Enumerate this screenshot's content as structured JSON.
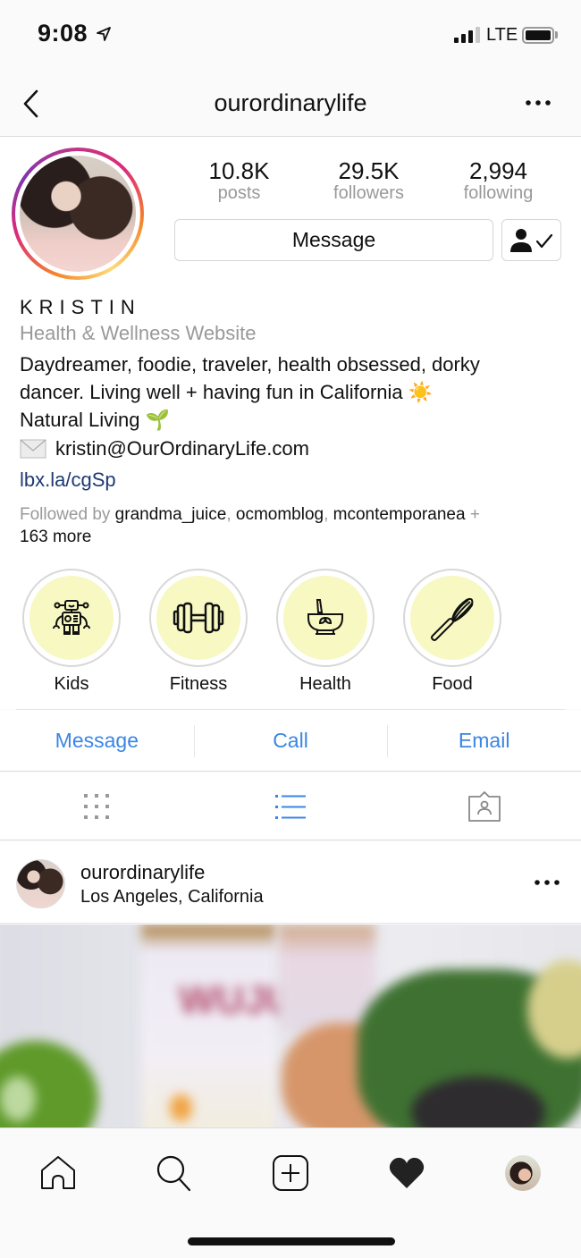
{
  "status_bar": {
    "time": "9:08",
    "network": "LTE",
    "signal_bars_active": 3,
    "signal_bars_total": 4,
    "battery_level": 1.0
  },
  "nav": {
    "title": "ourordinarylife",
    "back_icon": "chevron-left-icon",
    "more_icon": "ellipsis-icon"
  },
  "profile": {
    "stats": [
      {
        "value": "10.8K",
        "label": "posts"
      },
      {
        "value": "29.5K",
        "label": "followers"
      },
      {
        "value": "2,994",
        "label": "following"
      }
    ],
    "message_button": "Message",
    "following_icon": "person-check-icon",
    "display_name": "KRISTIN",
    "category": "Health & Wellness Website",
    "bio_line1": "Daydreamer, foodie, traveler, health obsessed, dorky",
    "bio_line2": "dancer. Living well + having fun in California",
    "bio_line2_emoji": "☀️",
    "bio_line3": "Natural Living",
    "bio_line3_emoji": "🌱",
    "email_emoji": "✉️",
    "email": "kristin@OurOrdinaryLife.com",
    "link": "lbx.la/cgSp",
    "followed_by_prefix": "Followed by",
    "followed_by_names": [
      "grandma_juice",
      "ocmomblog",
      "mcontemporanea"
    ],
    "followed_by_suffix": "+",
    "followed_by_more": "163 more"
  },
  "highlights": [
    {
      "label": "Kids",
      "icon": "robot-icon"
    },
    {
      "label": "Fitness",
      "icon": "dumbbell-icon"
    },
    {
      "label": "Health",
      "icon": "mortar-pestle-icon"
    },
    {
      "label": "Food",
      "icon": "whisk-icon"
    }
  ],
  "contact": {
    "message": "Message",
    "call": "Call",
    "email": "Email"
  },
  "view_tabs": [
    {
      "name": "grid",
      "active": false
    },
    {
      "name": "list",
      "active": true
    },
    {
      "name": "tagged",
      "active": false
    }
  ],
  "post": {
    "username": "ourordinarylife",
    "location": "Los Angeles, California"
  },
  "tab_bar": [
    "home",
    "search",
    "new-post",
    "activity",
    "profile"
  ],
  "colors": {
    "link_blue": "#3a86e4",
    "bio_link": "#1e3a73",
    "highlight_fill": "#f7f8c2",
    "active_tab": "#3a86e4"
  }
}
